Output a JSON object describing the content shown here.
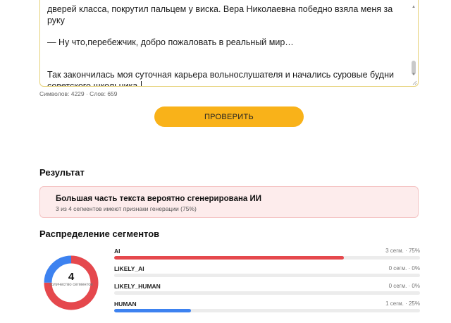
{
  "editor": {
    "lines": [
      "дверей класса, покрутил пальцем у виска. Вера Николаевна победно взяла меня за руку",
      "",
      "— Ну что,перебежчик, добро пожаловать в реальный мир…",
      "",
      "",
      "Так закончилась моя суточная карьера вольнослушателя и начались суровые будни советского школьника."
    ]
  },
  "counter": "Символов: 4229 · Слов: 659",
  "check_button_label": "ПРОВЕРИТЬ",
  "result": {
    "title": "Результат",
    "headline": "Большая часть текста вероятно сгенерирована ИИ",
    "subtext": "3 из 4 сегментов имеют признаки генерации (75%)"
  },
  "distribution": {
    "title": "Распределение сегментов",
    "total": "4",
    "total_caption": "количество сегментов",
    "segments": [
      {
        "label": "AI",
        "stat": "3 сегм. · 75%",
        "fraction": 0.75,
        "color": "#e5484d"
      },
      {
        "label": "LIKELY_AI",
        "stat": "0 сегм. · 0%",
        "fraction": 0,
        "color": "#f08a5d"
      },
      {
        "label": "LIKELY_HUMAN",
        "stat": "0 сегм. · 0%",
        "fraction": 0,
        "color": "#6aa5f5"
      },
      {
        "label": "HUMAN",
        "stat": "1 сегм. · 25%",
        "fraction": 0.25,
        "color": "#3d82f0"
      }
    ]
  },
  "colors": {
    "accent": "#f9b219",
    "ai": "#e5484d",
    "human": "#3d82f0",
    "alert_bg": "#fdecec"
  }
}
